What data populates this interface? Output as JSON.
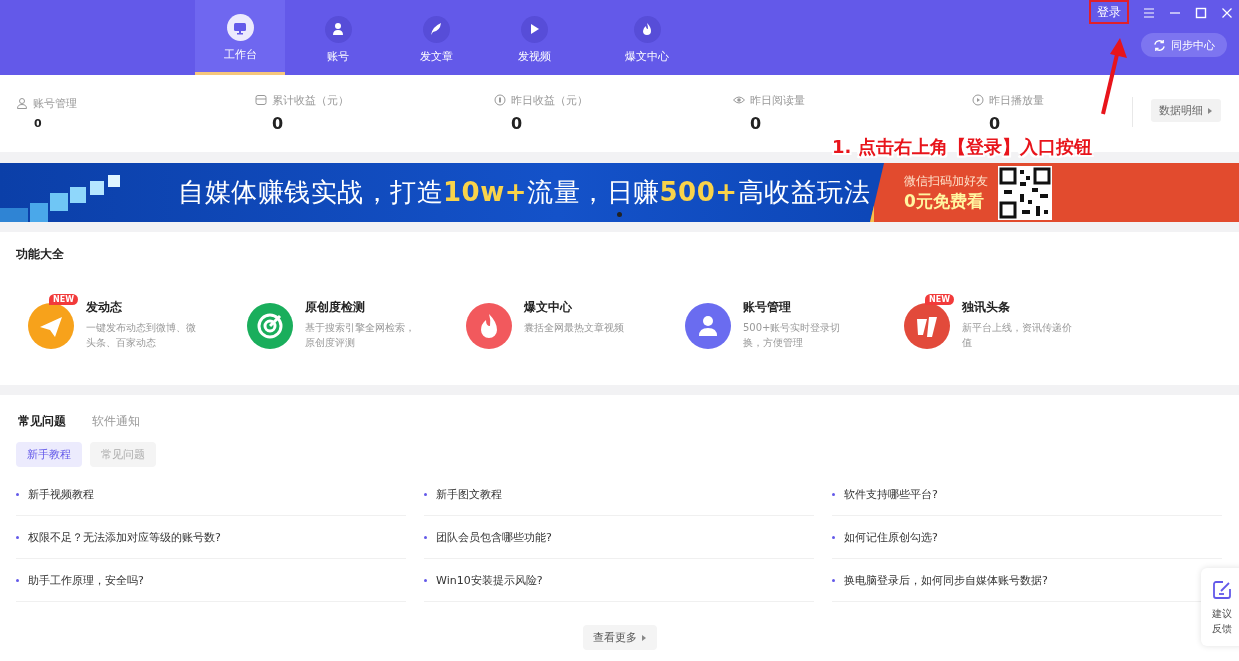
{
  "header": {
    "tabs": [
      {
        "label": "工作台",
        "selected": true
      },
      {
        "label": "账号",
        "selected": false
      },
      {
        "label": "发文章",
        "selected": false
      },
      {
        "label": "发视频",
        "selected": false
      },
      {
        "label": "爆文中心",
        "selected": false
      }
    ],
    "login": "登录",
    "sync": "同步中心"
  },
  "stats": {
    "items": [
      {
        "label": "账号管理",
        "value": "0"
      },
      {
        "label": "累计收益（元）",
        "value": "0"
      },
      {
        "label": "昨日收益（元）",
        "value": "0"
      },
      {
        "label": "昨日阅读量",
        "value": "0"
      },
      {
        "label": "昨日播放量",
        "value": "0"
      }
    ],
    "detail_button": "数据明细"
  },
  "banner": {
    "headline": "自媒体赚钱实战，打造**10w+**流量，日赚**500+**高收益玩法",
    "side_top": "微信扫码加好友",
    "side_bottom": "0元免费看"
  },
  "features": {
    "title": "功能大全",
    "items": [
      {
        "title": "发动态",
        "desc": "一键发布动态到微博、微头条、百家动态",
        "color": "#f7a21b",
        "badge": "NEW"
      },
      {
        "title": "原创度检测",
        "desc": "基于搜索引擎全网检索，原创度评测",
        "color": "#1aae5c"
      },
      {
        "title": "爆文中心",
        "desc": "囊括全网最热文章视频",
        "color": "#f2595d"
      },
      {
        "title": "账号管理",
        "desc": "500+账号实时登录切换，方便管理",
        "color": "#6a6cf0"
      },
      {
        "title": "独讯头条",
        "desc": "新平台上线，资讯传递价值",
        "color": "#e24a3b",
        "badge": "NEW"
      }
    ]
  },
  "faq": {
    "tabs": [
      {
        "label": "常见问题",
        "selected": true
      },
      {
        "label": "软件通知",
        "selected": false
      }
    ],
    "subtabs": [
      {
        "label": "新手教程",
        "selected": true
      },
      {
        "label": "常见问题",
        "selected": false
      }
    ],
    "items": [
      "新手视频教程",
      "新手图文教程",
      "软件支持哪些平台?",
      "权限不足？无法添加对应等级的账号数?",
      "团队会员包含哪些功能?",
      "如何记住原创勾选?",
      "助手工作原理，安全吗?",
      "Win10安装提示风险?",
      "换电脑登录后，如何同步自媒体账号数据?"
    ],
    "more": "查看更多"
  },
  "feedback": {
    "label": "建议反馈"
  },
  "annotation": {
    "text": "1. 点击右上角【登录】入口按钮"
  }
}
